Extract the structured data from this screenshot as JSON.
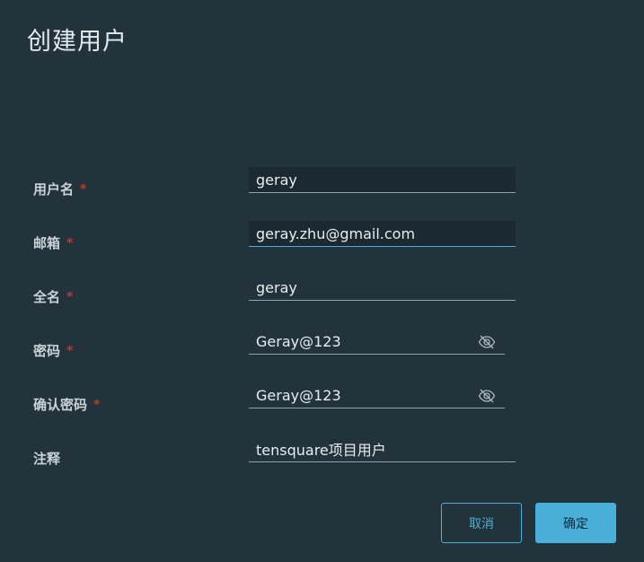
{
  "dialog": {
    "title": "创建用户"
  },
  "form": {
    "username": {
      "label": "用户名",
      "required": "*",
      "value": "geray"
    },
    "email": {
      "label": "邮箱",
      "required": "*",
      "value": "geray.zhu@gmail.com"
    },
    "fullname": {
      "label": "全名",
      "required": "*",
      "value": "geray"
    },
    "password": {
      "label": "密码",
      "required": "*",
      "value": "Geray@123",
      "icon": "eye-slash-icon"
    },
    "confirm_password": {
      "label": "确认密码",
      "required": "*",
      "value": "Geray@123",
      "icon": "eye-slash-icon"
    },
    "comment": {
      "label": "注释",
      "value": "tensquare项目用户"
    }
  },
  "buttons": {
    "cancel_label": "取消",
    "ok_label": "确定"
  },
  "colors": {
    "background": "#22333b",
    "accent": "#49afd9",
    "required": "#c0392b"
  }
}
